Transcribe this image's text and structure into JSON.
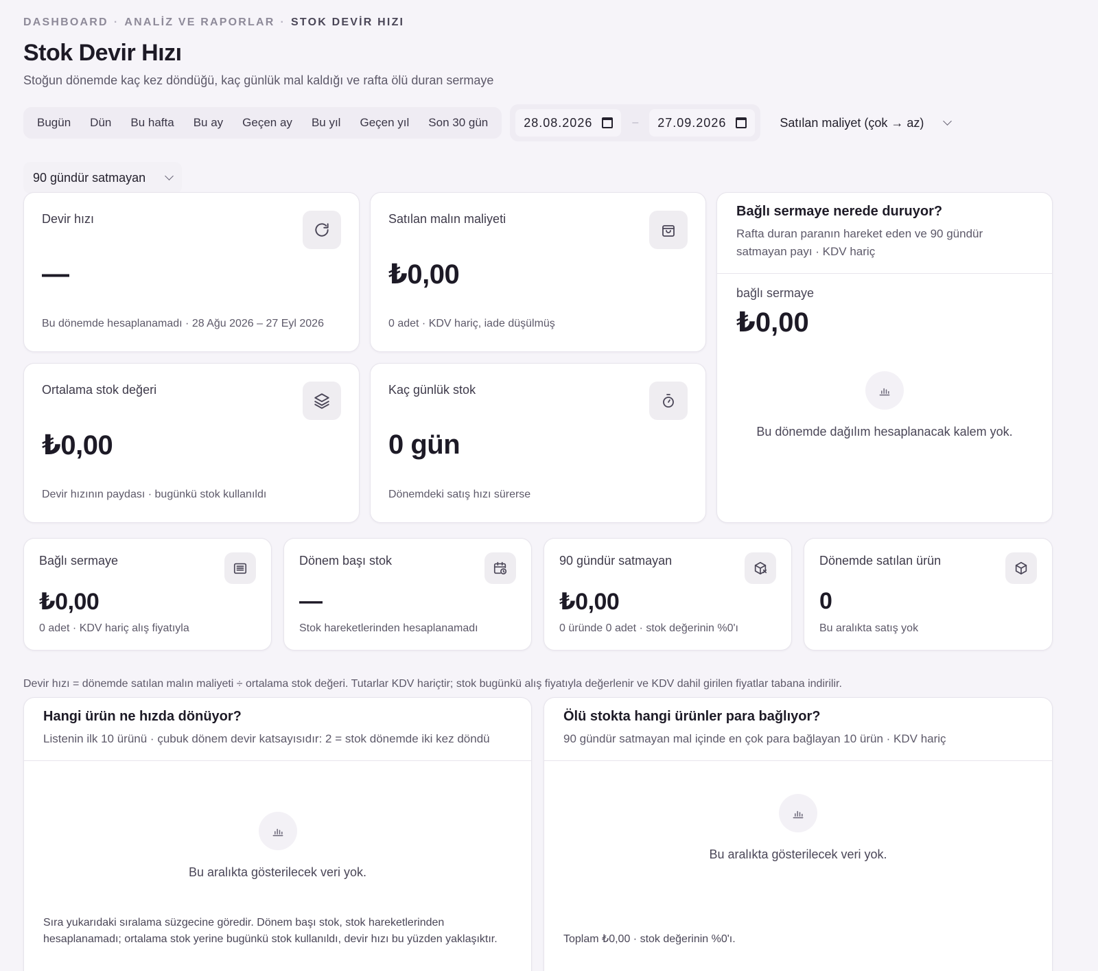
{
  "breadcrumb": [
    "DASHBOARD",
    "ANALİZ VE RAPORLAR",
    "STOK DEVİR HIZI"
  ],
  "breadcrumb_sep": "·",
  "page": {
    "title": "Stok Devir Hızı",
    "subtitle": "Stoğun dönemde kaç kez döndüğü, kaç günlük mal kaldığı ve rafta ölü duran sermaye"
  },
  "quick_ranges": [
    "Bugün",
    "Dün",
    "Bu hafta",
    "Bu ay",
    "Geçen ay",
    "Bu yıl",
    "Geçen yıl",
    "Son 30 gün"
  ],
  "date_range": {
    "start": "28.08.2026",
    "separator": "–",
    "end": "27.09.2026"
  },
  "sort_select": {
    "value": "Satılan maliyet (çok → az)"
  },
  "stale_filter": {
    "value": "90 gündür satmayan"
  },
  "kpis": {
    "turnover": {
      "label": "Devir hızı",
      "value": "—",
      "note": "Bu dönemde hesaplanamadı · 28 Ağu 2026 – 27 Eyl 2026",
      "icon": "refresh-icon"
    },
    "cogs": {
      "label": "Satılan malın maliyeti",
      "value": "₺0,00",
      "note": "0 adet · KDV hariç, iade düşülmüş",
      "icon": "shopping-bag-icon"
    },
    "avg_stock": {
      "label": "Ortalama stok değeri",
      "value": "₺0,00",
      "note": "Devir hızının paydası · bugünkü stok kullanıldı",
      "icon": "layers-icon"
    },
    "days_stock": {
      "label": "Kaç günlük stok",
      "value": "0 gün",
      "note": "Dönemdeki satış hızı sürerse",
      "icon": "stopwatch-icon"
    }
  },
  "capital_panel": {
    "title": "Bağlı sermaye nerede duruyor?",
    "subtitle": "Rafta duran paranın hareket eden ve 90 gündür satmayan payı · KDV hariç",
    "metric_label": "bağlı sermaye",
    "metric_value": "₺0,00",
    "empty_text": "Bu dönemde dağılım hesaplanacak kalem yok."
  },
  "small_kpis": {
    "tied_capital": {
      "label": "Bağlı sermaye",
      "value": "₺0,00",
      "note": "0 adet · KDV hariç alış fiyatıyla",
      "icon": "archive-icon"
    },
    "opening_stock": {
      "label": "Dönem başı stok",
      "value": "—",
      "note": "Stok hareketlerinden hesaplanamadı",
      "icon": "calendar-clock-icon"
    },
    "dead_stock": {
      "label": "90 gündür satmayan",
      "value": "₺0,00",
      "note": "0 üründe 0 adet · stok değerinin %0'ı",
      "icon": "box-x-icon"
    },
    "sold_products": {
      "label": "Dönemde satılan ürün",
      "value": "0",
      "note": "Bu aralıkta satış yok",
      "icon": "box-icon"
    }
  },
  "footnote": "Devir hızı = dönemde satılan malın maliyeti ÷ ortalama stok değeri. Tutarlar KDV hariçtir; stok bugünkü alış fiyatıyla değerlenir ve KDV dahil girilen fiyatlar tabana indirilir.",
  "speed_panel": {
    "title": "Hangi ürün ne hızda dönüyor?",
    "subtitle": "Listenin ilk 10 ürünü · çubuk dönem devir katsayısıdır: 2 = stok dönemde iki kez döndü",
    "empty_text": "Bu aralıkta gösterilecek veri yok.",
    "footer": "Sıra yukarıdaki sıralama süzgecine göredir. Dönem başı stok, stok hareketlerinden hesaplanamadı; ortalama stok yerine bugünkü stok kullanıldı, devir hızı bu yüzden yaklaşıktır."
  },
  "dead_panel": {
    "title": "Ölü stokta hangi ürünler para bağlıyor?",
    "subtitle": "90 gündür satmayan mal içinde en çok para bağlayan 10 ürün · KDV hariç",
    "empty_text": "Bu aralıkta gösterilecek veri yok.",
    "footer": "Toplam ₺0,00 · stok değerinin %0'ı."
  }
}
